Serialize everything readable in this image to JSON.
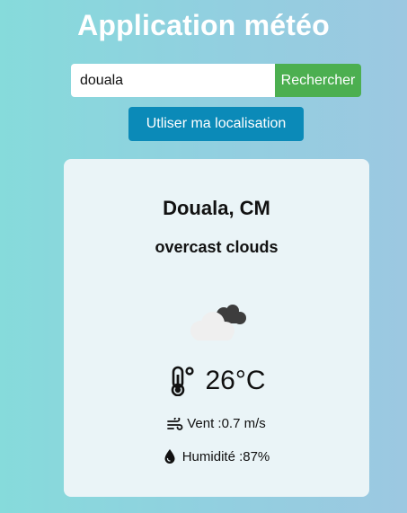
{
  "app": {
    "title": "Application météo"
  },
  "search": {
    "value": "douala",
    "button_label": "Rechercher"
  },
  "location_button": {
    "label": "Utliser ma localisation"
  },
  "weather": {
    "city": "Douala, CM",
    "description": "overcast clouds",
    "icon": "overcast-clouds-icon",
    "temperature": "26°C",
    "wind": "Vent :0.7 m/s",
    "humidity": "Humidité :87%"
  },
  "colors": {
    "search_button": "#4caf50",
    "location_button": "#0b8ab8",
    "card_background": "#eaf4f7"
  }
}
